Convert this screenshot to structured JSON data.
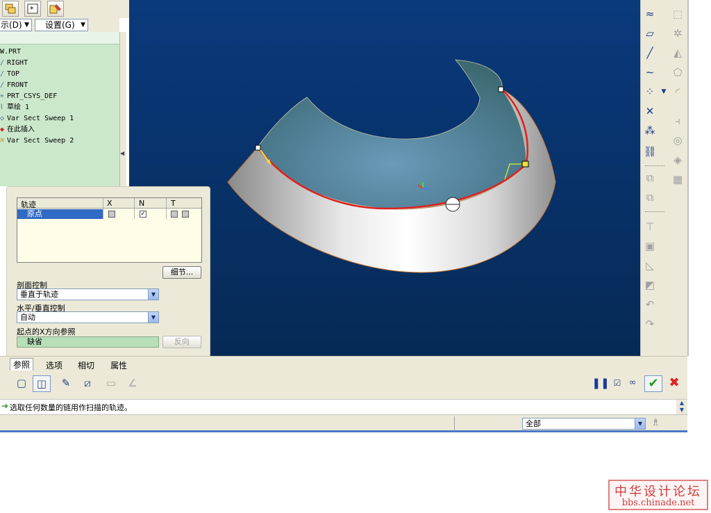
{
  "menus": {
    "display_label": "示(D)",
    "settings_label": "设置(G)"
  },
  "model_tree": {
    "items": [
      {
        "icon": "",
        "label": "W.PRT"
      },
      {
        "icon": "/",
        "label": "RIGHT"
      },
      {
        "icon": "/",
        "label": "TOP"
      },
      {
        "icon": "/",
        "label": "FRONT"
      },
      {
        "icon": "⌖",
        "label": "PRT_CSYS_DEF"
      },
      {
        "icon": "⌇",
        "label": "草绘 1"
      },
      {
        "icon": "◇",
        "label": "Var Sect Sweep 1"
      },
      {
        "icon": "◆",
        "label": "在此插入"
      },
      {
        "icon": "⌘",
        "label": "Var Sect Sweep 2"
      }
    ]
  },
  "references_panel": {
    "table": {
      "headers": [
        "轨迹",
        "X",
        "N",
        "T"
      ],
      "rows": [
        {
          "name": "原点",
          "x_checked": false,
          "n_checked": true,
          "t_checked": false
        }
      ]
    },
    "details_button": "细节...",
    "section_control_label": "剖面控制",
    "section_control_value": "垂直于轨迹",
    "hv_control_label": "水平/垂直控制",
    "hv_control_value": "自动",
    "x_direction_label": "起点的X方向参照",
    "x_direction_value": "缺省",
    "flip_button": "反向"
  },
  "dashboard": {
    "tabs": [
      "参照",
      "选项",
      "相切",
      "属性"
    ],
    "active_tab": "参照"
  },
  "message": "选取任何数量的链用作扫描的轨迹。",
  "status": {
    "filter_value": "全部"
  },
  "watermark": {
    "title": "中华设计论坛",
    "url": "bbs.chinade.net"
  },
  "colors": {
    "viewport_top": "#0a3a7c",
    "viewport_bottom": "#062a55",
    "trajectory": "#e02020",
    "tree_bg": "#cce8cc",
    "panel_bg": "#ece9d8"
  }
}
